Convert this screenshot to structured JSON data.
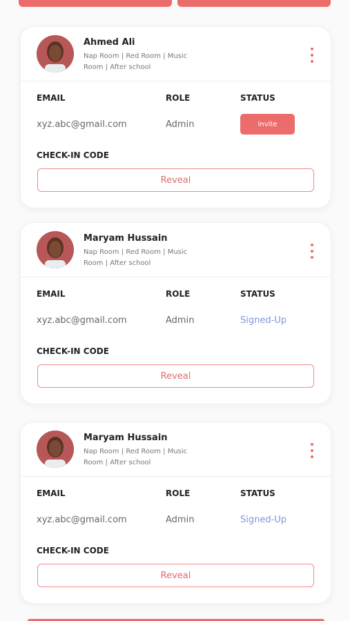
{
  "colors": {
    "accent": "#ec6b6b",
    "status_signed_up": "#7f95e0",
    "text_dark": "#222222",
    "text_muted": "#777777"
  },
  "labels": {
    "email": "EMAIL",
    "role": "ROLE",
    "status": "STATUS",
    "checkin": "CHECK-IN CODE",
    "reveal": "Reveal"
  },
  "users": [
    {
      "name": "Ahmed Ali",
      "tags": "Nap Room | Red Room | Music Room | After school",
      "email": "xyz.abc@gmail.com",
      "role": "Admin",
      "status": "Invite",
      "status_type": "button"
    },
    {
      "name": "Maryam Hussain",
      "tags": "Nap Room | Red Room | Music Room | After school",
      "email": "xyz.abc@gmail.com",
      "role": "Admin",
      "status": "Signed-Up",
      "status_type": "text"
    },
    {
      "name": "Maryam Hussain",
      "tags": "Nap Room | Red Room | Music Room | After school",
      "email": "xyz.abc@gmail.com",
      "role": "Admin",
      "status": "Signed-Up",
      "status_type": "text"
    }
  ],
  "icons": {
    "menu": "kebab-menu-icon",
    "avatar": "user-avatar"
  }
}
